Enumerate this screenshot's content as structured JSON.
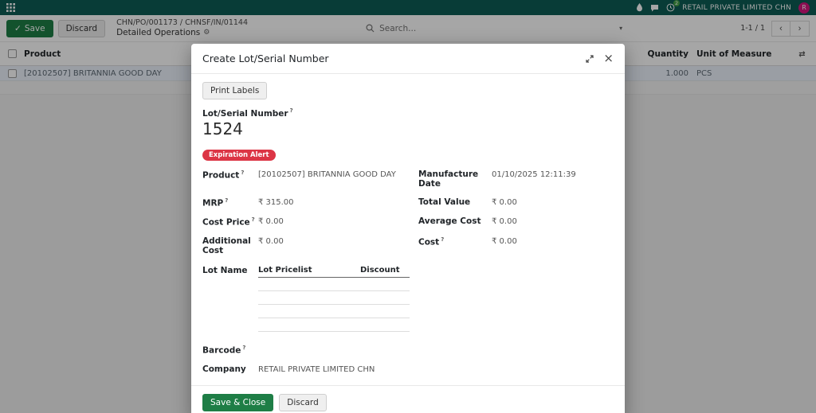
{
  "colors": {
    "navbar": "#0d5c55",
    "accent": "#1e7e46",
    "avatar": "#d6167e",
    "alert": "#dc3545",
    "row-highlight": "#edf3fc"
  },
  "icons": {
    "check": "✓",
    "gear": "⚙",
    "caret": "▾",
    "close": "×",
    "arrow_right": "→",
    "pager_prev": "‹",
    "pager_next": "›",
    "columns": "⇄"
  },
  "topbar": {
    "company": "RETAIL PRIVATE LIMITED CHN",
    "avatar_initial": "R",
    "activity_badge": "2"
  },
  "control_panel": {
    "save_label": "Save",
    "discard_label": "Discard",
    "breadcrumb": {
      "items": [
        "CHN/PO/001173",
        "CHNSF/IN/01144"
      ],
      "separator": "/"
    },
    "subtitle": "Detailed Operations",
    "search_placeholder": "Search...",
    "pager_value": "1-1 / 1"
  },
  "table": {
    "headers": {
      "product": "Product",
      "quantity": "Quantity",
      "uom": "Unit of Measure"
    },
    "rows": [
      {
        "product": "[20102507] BRITANNIA GOOD DAY",
        "quantity": "1.000",
        "uom": "PCS"
      }
    ]
  },
  "modal": {
    "title": "Create Lot/Serial Number",
    "help_marker": "?",
    "print_labels_label": "Print Labels",
    "lot_serial_label": "Lot/Serial Number",
    "lot_serial_value": "1524",
    "expiration_alert": "Expiration Alert",
    "fields_left": [
      {
        "label": "Product",
        "value": "[20102507] BRITANNIA GOOD DAY"
      },
      {
        "label": "MRP",
        "value": "₹ 315.00"
      },
      {
        "label": "Cost Price",
        "value": "₹ 0.00"
      },
      {
        "label": "Additional Cost",
        "value": "₹ 0.00"
      }
    ],
    "fields_right": [
      {
        "label": "Manufacture Date",
        "value": "01/10/2025 12:11:39"
      },
      {
        "label": "Total Value",
        "value": "₹ 0.00"
      },
      {
        "label": "Average Cost",
        "value": "₹ 0.00"
      },
      {
        "label": "Cost",
        "value": "₹ 0.00"
      }
    ],
    "lot_name_label": "Lot Name",
    "pricelist": {
      "col_pricelist": "Lot Pricelist",
      "col_discount": "Discount"
    },
    "barcode_label": "Barcode",
    "company_label": "Company",
    "company_value": "RETAIL PRIVATE LIMITED CHN",
    "save_close_label": "Save & Close",
    "discard_label": "Discard"
  }
}
